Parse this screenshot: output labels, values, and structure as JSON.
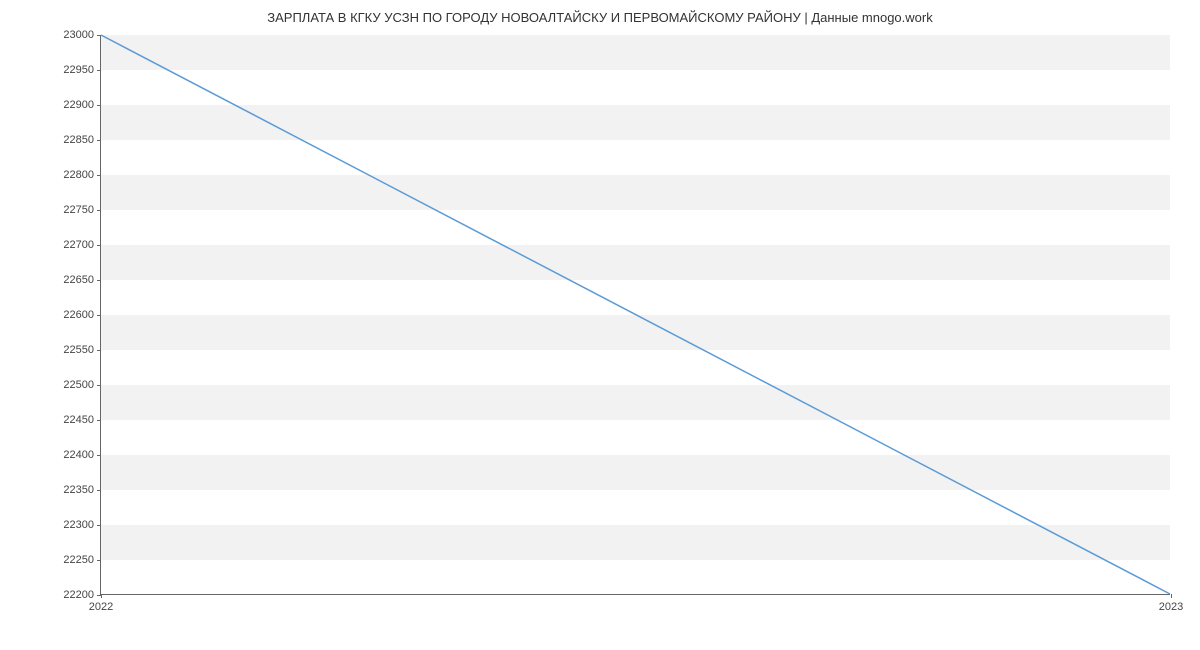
{
  "chart_data": {
    "type": "line",
    "title": "ЗАРПЛАТА В КГКУ УСЗН ПО ГОРОДУ НОВОАЛТАЙСКУ И ПЕРВОМАЙСКОМУ РАЙОНУ | Данные mnogo.work",
    "x": [
      2022,
      2023
    ],
    "values": [
      23000,
      22200
    ],
    "xlabel": "",
    "ylabel": "",
    "xticks": [
      2022,
      2023
    ],
    "yticks": [
      22200,
      22250,
      22300,
      22350,
      22400,
      22450,
      22500,
      22550,
      22600,
      22650,
      22700,
      22750,
      22800,
      22850,
      22900,
      22950,
      23000
    ],
    "xlim": [
      2022,
      2023
    ],
    "ylim": [
      22200,
      23000
    ],
    "line_color": "#5b9bd5",
    "band_color": "#f2f2f2"
  }
}
